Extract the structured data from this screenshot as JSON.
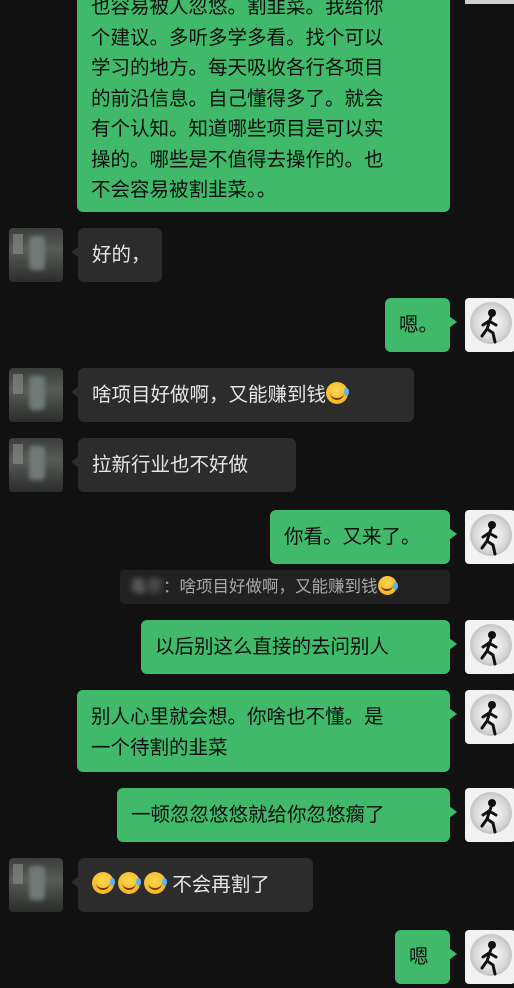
{
  "messages": [
    {
      "side": "me",
      "lines": [
        "也容易被人忽悠。割韭菜。我给你",
        "个建议。多听多学多看。找个可以",
        "学习的地方。每天吸收各行各项目",
        "的前沿信息。自己懂得多了。就会",
        "有个认知。知道哪些项目是可以实",
        "操的。哪些是不值得去操作的。也",
        "不会容易被割韭菜。。"
      ]
    },
    {
      "side": "other",
      "text": "好的，"
    },
    {
      "side": "me",
      "text": "嗯。"
    },
    {
      "side": "other",
      "text": "啥项目好做啊，又能赚到钱",
      "emoji": "face-with-tears-of-joy"
    },
    {
      "side": "other",
      "text": "拉新行业也不好做"
    },
    {
      "side": "me",
      "text": "你看。又来了。"
    },
    {
      "side": "me",
      "text": "以后别这么直接的去问别人"
    },
    {
      "side": "me",
      "lines": [
        "别人心里就会想。你啥也不懂。是",
        "一个待割的韭菜"
      ]
    },
    {
      "side": "me",
      "text": "一顿忽忽悠悠就给你忽悠瘸了"
    },
    {
      "side": "other",
      "text": "不会再割了",
      "emoji": "face-with-tears-of-joy"
    },
    {
      "side": "me",
      "text": "嗯"
    }
  ],
  "quote": {
    "name": "毒宗",
    "text": "啥项目好做啊，又能赚到钱",
    "emoji": "face-with-tears-of-joy"
  },
  "colors": {
    "background": "#111111",
    "my_bubble": "#40ba6a",
    "their_bubble": "#2c2c2c",
    "quote_bg": "#212121"
  }
}
